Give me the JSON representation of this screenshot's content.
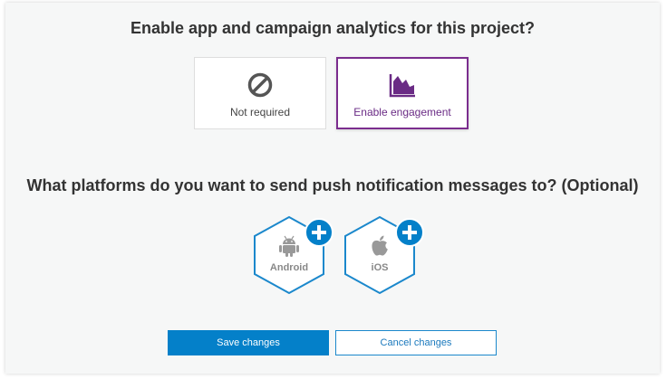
{
  "analytics": {
    "question": "Enable app and campaign analytics for this project?",
    "options": [
      {
        "label": "Not required",
        "icon": "prohibited-icon",
        "selected": false
      },
      {
        "label": "Enable engagement",
        "icon": "area-chart-icon",
        "selected": true
      }
    ]
  },
  "platforms": {
    "question": "What platforms do you want to send push notification messages to? (Optional)",
    "items": [
      {
        "label": "Android",
        "icon": "android-icon",
        "action_icon": "plus-icon"
      },
      {
        "label": "iOS",
        "icon": "apple-icon",
        "action_icon": "plus-icon"
      }
    ]
  },
  "actions": {
    "save_label": "Save changes",
    "cancel_label": "Cancel changes"
  },
  "colors": {
    "accent_purple": "#7b2d8e",
    "primary_blue": "#0480c9",
    "hex_border_blue": "#1b88cc",
    "panel_background": "#f6f7f7"
  }
}
